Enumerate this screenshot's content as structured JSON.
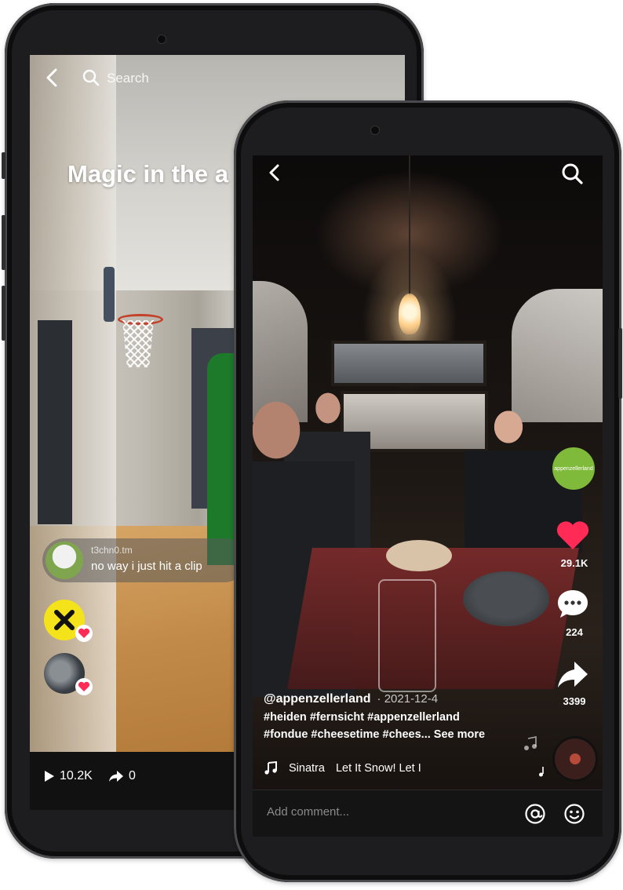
{
  "back_phone": {
    "search_placeholder": "Search",
    "title": "Magic in the a",
    "live_comment": {
      "username": "t3chn0.tm",
      "text": "no way i just hit a clip"
    },
    "stats": {
      "plays": "10.2K",
      "shares": "0"
    }
  },
  "front_phone": {
    "brand_avatar_text": "appenzellerland",
    "likes": "29.1K",
    "comments": "224",
    "shares": "3399",
    "video": {
      "username": "@appenzellerland",
      "date": "· 2021-12-4",
      "caption_line1": "#heiden #fernsicht #appenzellerland",
      "caption_line2": "#fondue #cheesetime #chees...",
      "see_more": "See more",
      "music_artist": "Sinatra",
      "music_title": "Let It Snow! Let I"
    },
    "comment_placeholder": "Add comment..."
  },
  "colors": {
    "like_red": "#ff2a55",
    "brand_green": "#7fba3a",
    "gift_yellow": "#f4e21b"
  }
}
